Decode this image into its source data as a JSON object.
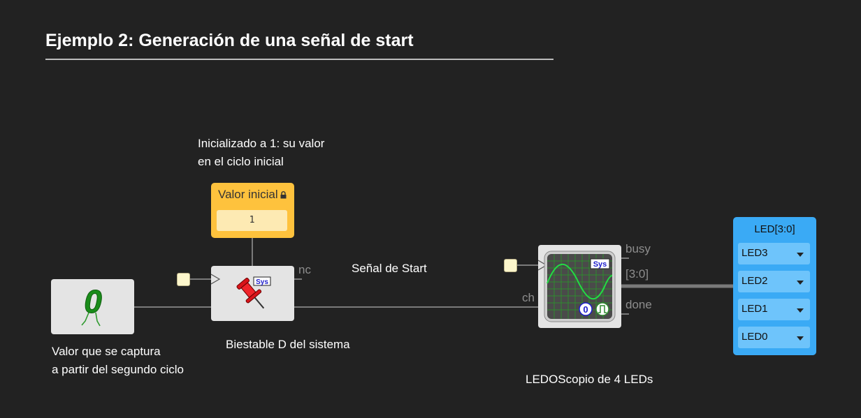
{
  "title": "Ejemplo 2: Generación de una señal de start",
  "comments": {
    "init_line1": "Inicializado a 1: su valor",
    "init_line2": "en el ciclo inicial",
    "capture_line1": "Valor que se captura",
    "capture_line2": "a partir del segundo ciclo",
    "start_signal": "Señal de Start",
    "biestable": "Biestable D del sistema",
    "ledoscopio": "LEDOScopio de 4 LEDs"
  },
  "constant_block": {
    "label": "Valor inicial",
    "value": "1",
    "icon": "lock-icon"
  },
  "zero_block": {
    "icon": "walking-zero-icon",
    "glyph": "0"
  },
  "flipflop_block": {
    "icon": "red-pin-icon",
    "badge": "Sys",
    "output_port": "nc"
  },
  "ledoscope_block": {
    "icon": "oscilloscope-icon",
    "badge": "Sys",
    "zero_badge": "0",
    "ports": {
      "in": "ch",
      "busy": "busy",
      "bus": "[3:0]",
      "done": "done"
    }
  },
  "led_panel": {
    "title": "LED[3:0]",
    "items": [
      {
        "label": "LED3"
      },
      {
        "label": "LED2"
      },
      {
        "label": "LED1"
      },
      {
        "label": "LED0"
      }
    ]
  },
  "colors": {
    "background": "#222222",
    "constant": "#fec23d",
    "led_panel": "#3aaaf5",
    "wire": "#7a7a7a",
    "scope_grid": "#2e8b2e",
    "zero_green": "#1a8c1a"
  }
}
